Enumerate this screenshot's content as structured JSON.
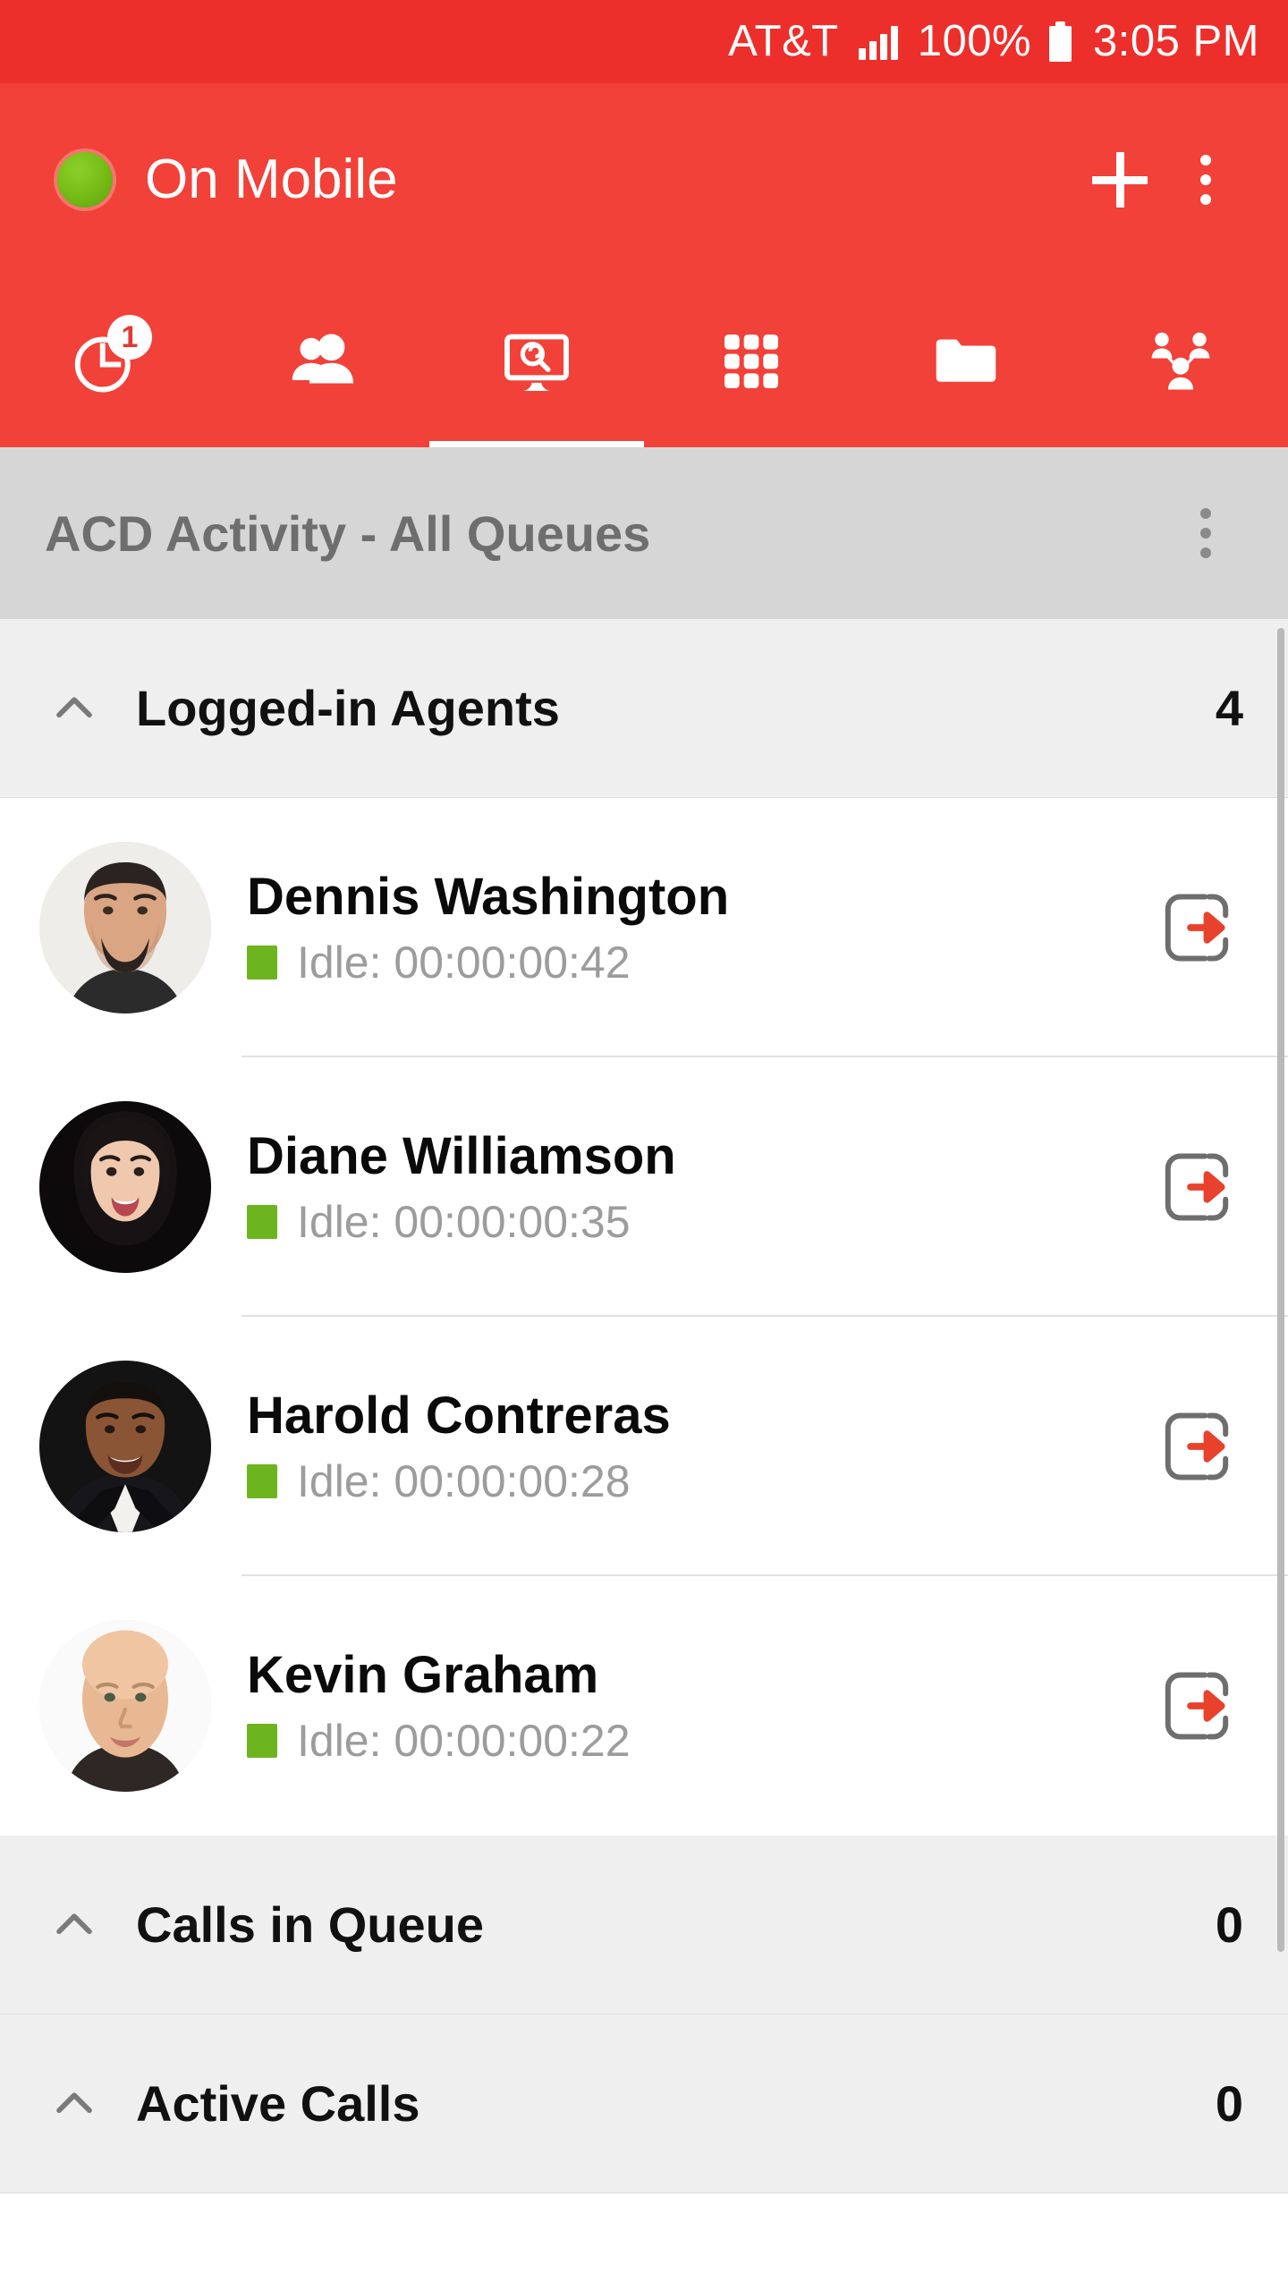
{
  "status_bar": {
    "carrier": "AT&T",
    "battery_percent": "100%",
    "time": "3:05 PM",
    "signal_icon": "signal-bars-icon",
    "battery_icon": "battery-full-icon"
  },
  "app_bar": {
    "presence_label": "On Mobile",
    "presence_color": "#79BF18",
    "add_icon": "plus-icon",
    "overflow_icon": "more-vertical-icon",
    "background_color": "#F24138"
  },
  "tabs": [
    {
      "name": "call-history",
      "icon": "clock-history-icon",
      "badge": "1",
      "active": false
    },
    {
      "name": "contacts",
      "icon": "people-icon",
      "badge": "",
      "active": false
    },
    {
      "name": "supervisor-monitor",
      "icon": "monitor-search-icon",
      "badge": "",
      "active": true
    },
    {
      "name": "dialpad",
      "icon": "dialpad-grid-icon",
      "badge": "",
      "active": false
    },
    {
      "name": "directory-folder",
      "icon": "folder-icon",
      "badge": "",
      "active": false
    },
    {
      "name": "conference",
      "icon": "group-network-icon",
      "badge": "",
      "active": false
    }
  ],
  "panel": {
    "title": "ACD Activity - All Queues",
    "overflow_icon": "more-vertical-icon",
    "title_color": "#6E6E6E",
    "background_color": "#D6D6D6"
  },
  "sections": [
    {
      "name": "logged-in-agents",
      "label": "Logged-in Agents",
      "count": "4",
      "collapse_icon": "chevron-up-icon",
      "expanded": true
    },
    {
      "name": "calls-in-queue",
      "label": "Calls in Queue",
      "count": "0",
      "collapse_icon": "chevron-up-icon",
      "expanded": true
    },
    {
      "name": "active-calls",
      "label": "Active Calls",
      "count": "0",
      "collapse_icon": "chevron-up-icon",
      "expanded": true
    }
  ],
  "agents": [
    {
      "name": "Dennis Washington",
      "state_text": "Idle: 00:00:00:42",
      "state_color": "#6CB51E",
      "avatar": "photo-male-beard",
      "signout_icon": "sign-out-icon"
    },
    {
      "name": "Diane Williamson",
      "state_text": "Idle: 00:00:00:35",
      "state_color": "#6CB51E",
      "avatar": "photo-female-dark-hair",
      "signout_icon": "sign-out-icon"
    },
    {
      "name": "Harold Contreras",
      "state_text": "Idle: 00:00:00:28",
      "state_color": "#6CB51E",
      "avatar": "photo-male-suit",
      "signout_icon": "sign-out-icon"
    },
    {
      "name": "Kevin Graham",
      "state_text": "Idle: 00:00:00:22",
      "state_color": "#6CB51E",
      "avatar": "photo-male-bald",
      "signout_icon": "sign-out-icon"
    }
  ],
  "colors": {
    "brand_red": "#F24138",
    "status_bar_red": "#ED2F2B",
    "accent_green": "#6CB51E",
    "signout_arrow": "#E8412C"
  }
}
